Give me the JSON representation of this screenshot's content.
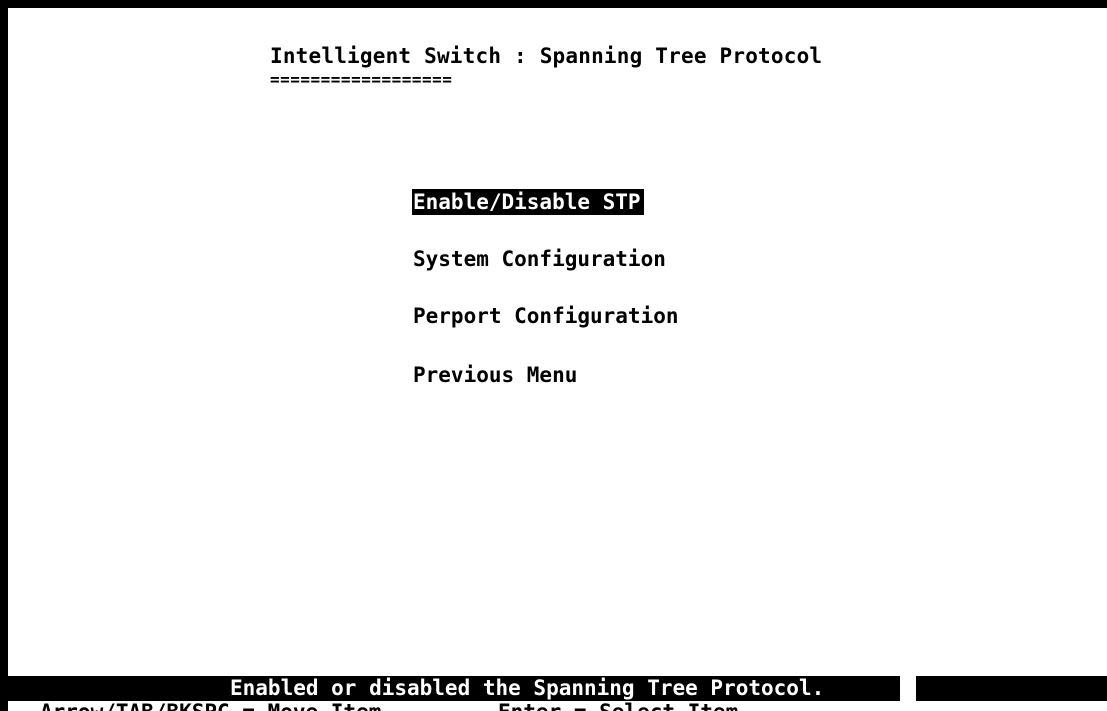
{
  "header": {
    "title": "Intelligent Switch : Spanning Tree Protocol",
    "underline": "=================="
  },
  "menu": {
    "items": [
      {
        "label": "Enable/Disable STP",
        "selected": true
      },
      {
        "label": "System Configuration",
        "selected": false
      },
      {
        "label": "Perport Configuration",
        "selected": false
      },
      {
        "label": "Previous Menu",
        "selected": false
      }
    ]
  },
  "status": {
    "message": "Enabled or disabled the Spanning Tree Protocol."
  },
  "help": {
    "move_hint": "Arrow/TAB/BKSPC = Move Item",
    "select_hint": "Enter = Select Item"
  },
  "colors": {
    "background": "#ffffff",
    "foreground": "#000000",
    "highlight_bg": "#000000",
    "highlight_fg": "#ffffff"
  }
}
